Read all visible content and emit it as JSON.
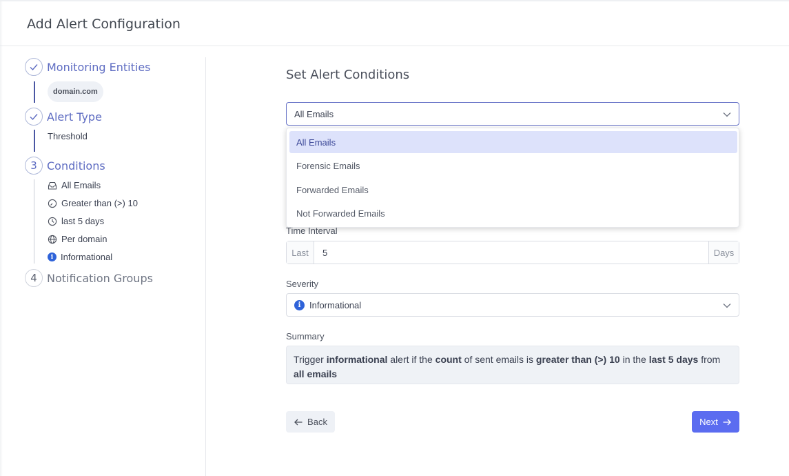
{
  "header": {
    "title": "Add Alert Configuration"
  },
  "steps": [
    {
      "label": "Monitoring Entities",
      "status": "done",
      "detail": "domain.com"
    },
    {
      "label": "Alert Type",
      "status": "done",
      "detail": "Threshold"
    },
    {
      "label": "Conditions",
      "status": "active",
      "number": "3",
      "details": [
        "All Emails",
        "Greater than (>) 10",
        "last 5 days",
        "Per domain",
        "Informational"
      ]
    },
    {
      "label": "Notification Groups",
      "status": "pending",
      "number": "4"
    }
  ],
  "main": {
    "title": "Set Alert Conditions",
    "email_type_select": {
      "value": "All Emails",
      "options": [
        "All Emails",
        "Forensic Emails",
        "Forwarded Emails",
        "Not Forwarded Emails"
      ],
      "selected_index": 0
    },
    "time_interval": {
      "label": "Time Interval",
      "prefix": "Last",
      "value": "5",
      "suffix": "Days"
    },
    "severity": {
      "label": "Severity",
      "value": "Informational"
    },
    "summary": {
      "label": "Summary",
      "parts": [
        "Trigger ",
        "informational",
        " alert if the ",
        "count",
        " of sent emails is ",
        "greater than (>) 10",
        " in the ",
        "last 5 days",
        " from ",
        "all emails"
      ]
    },
    "buttons": {
      "back": "Back",
      "next": "Next"
    }
  },
  "colors": {
    "accent": "#5b6cf0",
    "step_active": "#5e6cc2",
    "info": "#2f63d9"
  }
}
